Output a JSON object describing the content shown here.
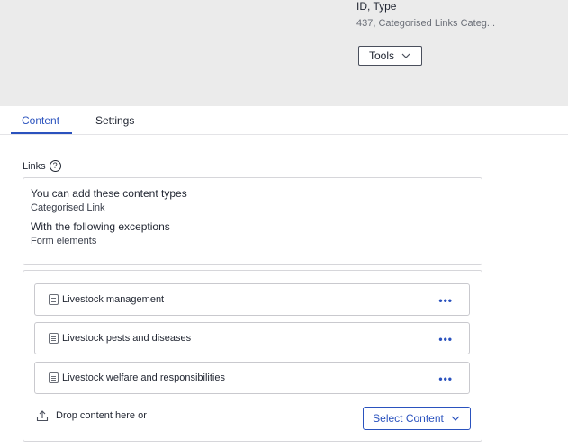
{
  "header": {
    "meta_label": "ID, Type",
    "meta_value": "437, Categorised Links Categ...",
    "tools_label": "Tools"
  },
  "tabs": [
    {
      "label": "Content",
      "active": true
    },
    {
      "label": "Settings",
      "active": false
    }
  ],
  "field": {
    "label": "Links",
    "help_icon": "question-circle-icon"
  },
  "info": {
    "allowed_title": "You can add these content types",
    "allowed_value": "Categorised Link",
    "exceptions_title": "With the following exceptions",
    "exceptions_value": "Form elements"
  },
  "items": [
    {
      "label": "Livestock management",
      "icon": "document-icon"
    },
    {
      "label": "Livestock pests and diseases",
      "icon": "document-icon"
    },
    {
      "label": "Livestock welfare and responsibilities",
      "icon": "document-icon"
    }
  ],
  "drop": {
    "text": "Drop content here or",
    "select_label": "Select Content"
  },
  "colors": {
    "accent": "#2a52be",
    "header_bg": "#ebebeb",
    "border": "#d6d6da"
  }
}
